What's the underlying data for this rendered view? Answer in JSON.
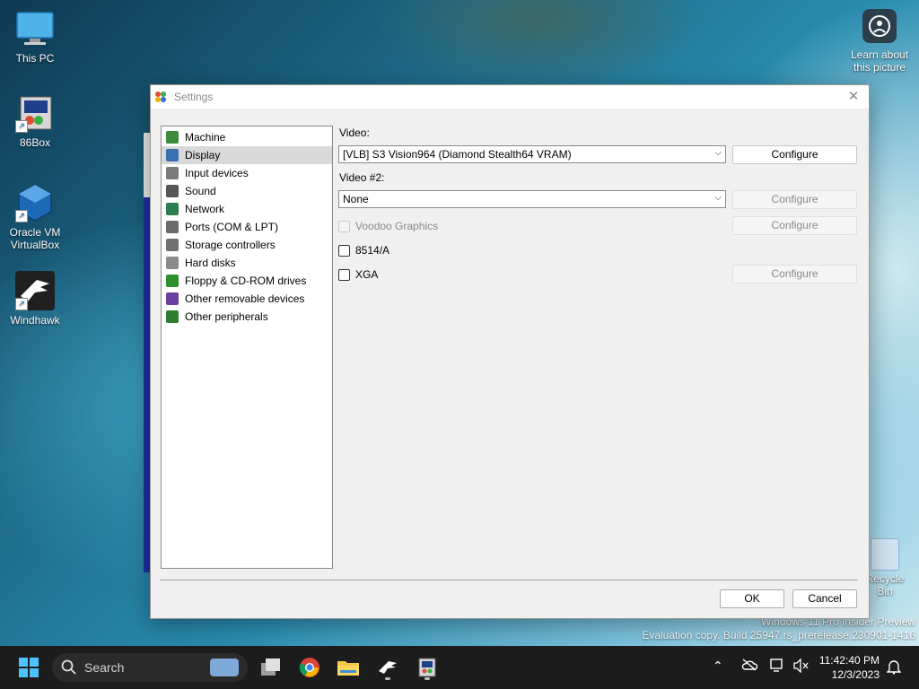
{
  "desktop": {
    "icons": [
      {
        "label": "This PC"
      },
      {
        "label": "86Box"
      },
      {
        "label": "Oracle VM VirtualBox"
      },
      {
        "label": "Windhawk"
      }
    ],
    "learn_about": "Learn about this picture",
    "recycle_bin": "Recycle Bin",
    "watermark_line1": "Windows 11 Pro Insider Preview",
    "watermark_line2": "Evaluation copy. Build 25947.rs_prerelease.230901-1416"
  },
  "window": {
    "title": "Settings",
    "close_glyph": "✕"
  },
  "tree": {
    "items": [
      {
        "label": "Machine",
        "icon": "machine-icon",
        "color": "#3c8c3c"
      },
      {
        "label": "Display",
        "icon": "display-icon",
        "color": "#3a6fb0"
      },
      {
        "label": "Input devices",
        "icon": "input-devices-icon",
        "color": "#7a7a7a"
      },
      {
        "label": "Sound",
        "icon": "sound-icon",
        "color": "#555555"
      },
      {
        "label": "Network",
        "icon": "network-icon",
        "color": "#2e7d4f"
      },
      {
        "label": "Ports (COM & LPT)",
        "icon": "ports-icon",
        "color": "#6b6b6b"
      },
      {
        "label": "Storage controllers",
        "icon": "storage-controllers-icon",
        "color": "#707070"
      },
      {
        "label": "Hard disks",
        "icon": "hard-disk-icon",
        "color": "#8a8a8a"
      },
      {
        "label": "Floppy & CD-ROM drives",
        "icon": "floppy-cdrom-icon",
        "color": "#2f8f2f"
      },
      {
        "label": "Other removable devices",
        "icon": "removable-devices-icon",
        "color": "#6b3fa0"
      },
      {
        "label": "Other peripherals",
        "icon": "peripherals-icon",
        "color": "#2e7d32"
      }
    ],
    "selected_index": 1
  },
  "display": {
    "video_label": "Video:",
    "video_value": "[VLB] S3 Vision964 (Diamond Stealth64 VRAM)",
    "configure": "Configure",
    "video2_label": "Video #2:",
    "video2_value": "None",
    "voodoo_label": "Voodoo Graphics",
    "ibm8514_label": "8514/A",
    "xga_label": "XGA"
  },
  "footer": {
    "ok": "OK",
    "cancel": "Cancel"
  },
  "taskbar": {
    "search_label": "Search",
    "time": "11:42:40 PM",
    "date": "12/3/2023"
  },
  "colors": {
    "accent": "#0067c0",
    "selection": "#d9d9d9",
    "taskbar": "#1c1c1c"
  }
}
